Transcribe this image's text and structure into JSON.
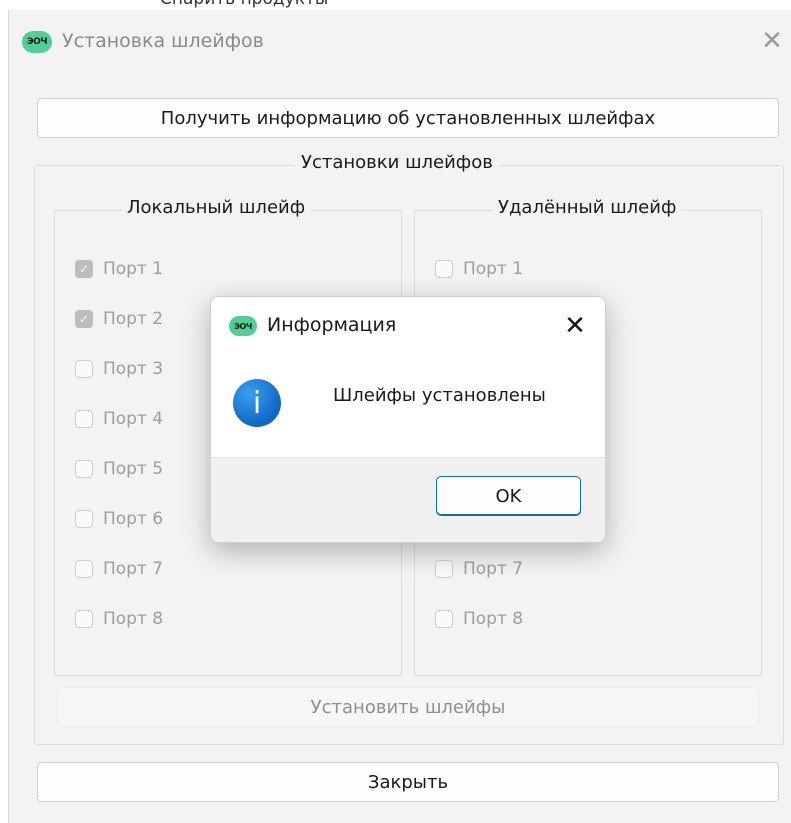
{
  "top_remnant_text": "Спарить продукты",
  "window": {
    "title": "Установка шлейфов",
    "logo_text": "ЭОЧ",
    "close_glyph": "✕"
  },
  "get_info_button": "Получить информацию об установленных шлейфах",
  "loops_group": {
    "title": "Установки шлейфов",
    "local": {
      "title": "Локальный шлейф",
      "ports": [
        {
          "label": "Порт 1",
          "checked": true
        },
        {
          "label": "Порт 2",
          "checked": true
        },
        {
          "label": "Порт 3",
          "checked": false
        },
        {
          "label": "Порт 4",
          "checked": false
        },
        {
          "label": "Порт 5",
          "checked": false
        },
        {
          "label": "Порт 6",
          "checked": false
        },
        {
          "label": "Порт 7",
          "checked": false
        },
        {
          "label": "Порт 8",
          "checked": false
        }
      ]
    },
    "remote": {
      "title": "Удалённый шлейф",
      "ports": [
        {
          "label": "Порт 1",
          "checked": false
        },
        {
          "label": "Порт 7",
          "checked": false
        },
        {
          "label": "Порт 8",
          "checked": false
        }
      ]
    },
    "install_button": "Установить шлейфы"
  },
  "close_button": "Закрыть",
  "dialog": {
    "title": "Информация",
    "logo_text": "ЭОЧ",
    "close_glyph": "✕",
    "icon": "info-icon",
    "icon_glyph": "i",
    "message": "Шлейфы установлены",
    "ok_button": "OK"
  },
  "colors": {
    "window_bg": "#f3f3f3",
    "logo": "#4fcf96",
    "info_icon": "#0f66c4",
    "ok_border": "#0f6cbd",
    "checked_box": "#bdbdbd"
  }
}
